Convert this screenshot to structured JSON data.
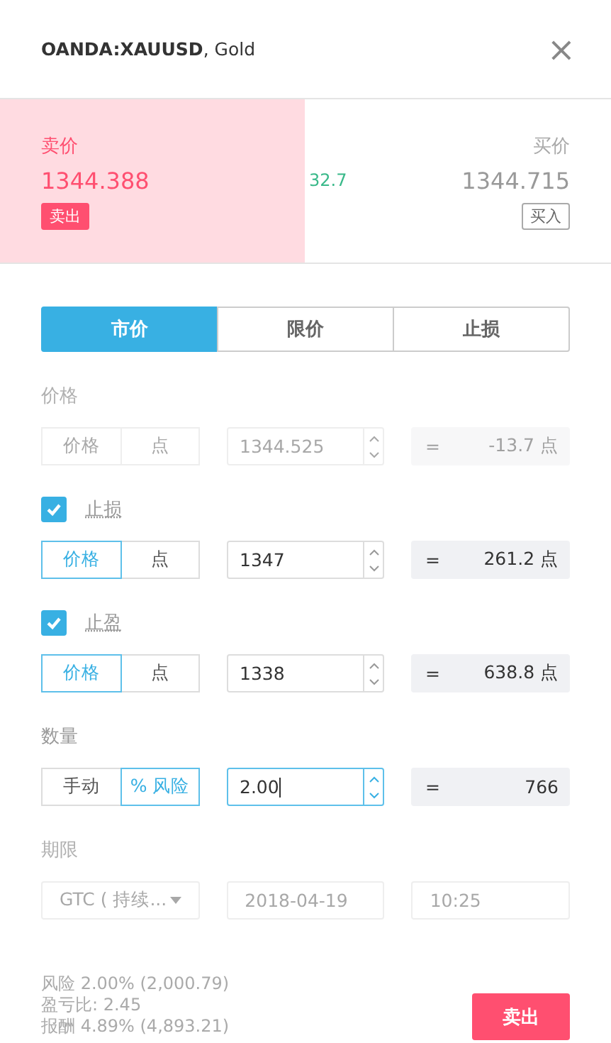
{
  "header": {
    "title": "**OANDA:XAUUSD**, Gold",
    "close": "×"
  },
  "quote": {
    "spread": "32.7",
    "sides": [
      {
        "kind": "sell",
        "selected": true,
        "label": "卖价",
        "price": "1344.388",
        "action": "卖出"
      },
      {
        "kind": "buy",
        "selected": false,
        "label": "买价",
        "price": "1344.715",
        "action": "买入"
      }
    ]
  },
  "order_tabs": [
    {
      "label": "市价",
      "selected": true
    },
    {
      "label": "限价",
      "selected": false
    },
    {
      "label": "止损",
      "selected": false
    }
  ],
  "sections": [
    {
      "kind": "field",
      "label": "价格",
      "disabled": true,
      "modes": [
        {
          "label": "价格",
          "selected": false
        },
        {
          "label": "点",
          "selected": false
        }
      ],
      "value": "1344.525",
      "focused": false,
      "sign": "=",
      "result": "-13.7 点"
    },
    {
      "kind": "field",
      "label": "止损",
      "checked": true,
      "disabled": false,
      "modes": [
        {
          "label": "价格",
          "selected": true
        },
        {
          "label": "点",
          "selected": false
        }
      ],
      "value": "1347",
      "focused": false,
      "sign": "=",
      "result": "261.2 点"
    },
    {
      "kind": "field",
      "label": "止盈",
      "checked": true,
      "disabled": false,
      "modes": [
        {
          "label": "价格",
          "selected": true
        },
        {
          "label": "点",
          "selected": false
        }
      ],
      "value": "1338",
      "focused": false,
      "sign": "=",
      "result": "638.8 点"
    },
    {
      "kind": "field",
      "label": "数量",
      "disabled": false,
      "modes": [
        {
          "label": "手动",
          "selected": false
        },
        {
          "label": "% 风险",
          "selected": true
        }
      ],
      "value": "2.00",
      "focused": true,
      "sign": "=",
      "result": "766"
    },
    {
      "kind": "expiry",
      "label": "期限",
      "disabled": true,
      "select": "GTC ( 持续...",
      "date": "2018-04-19",
      "time": "10:25"
    }
  ],
  "summary": [
    "风险 2.00% (2,000.79)",
    "盈亏比: 2.45",
    "报酬 4.89% (4,893.21)"
  ],
  "submit": {
    "label": "卖出"
  }
}
